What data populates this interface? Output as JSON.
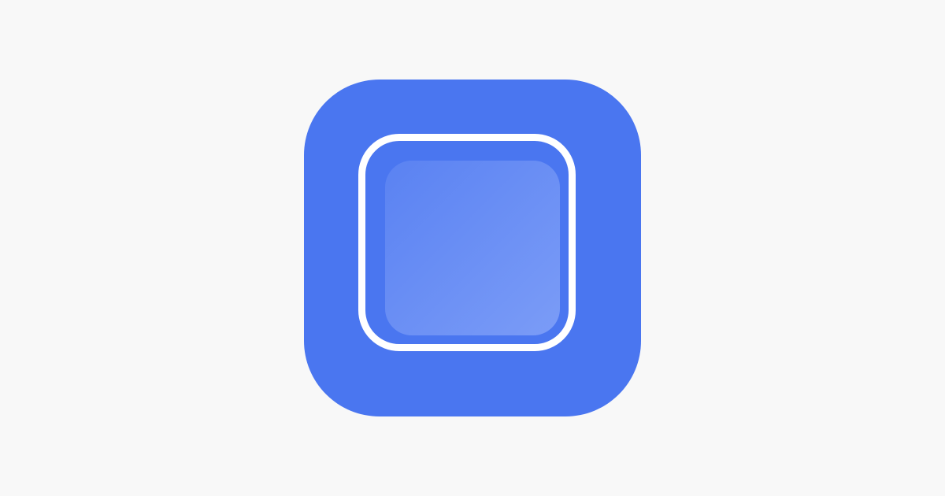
{
  "app_icon": {
    "semantic": "widget-icon",
    "colors": {
      "page_background": "#f8f8f8",
      "icon_background": "#4a76f0",
      "frame_stroke": "#ffffff",
      "tile_gradient_start": "#5a82f2",
      "tile_gradient_end": "#7b9cf7"
    }
  }
}
